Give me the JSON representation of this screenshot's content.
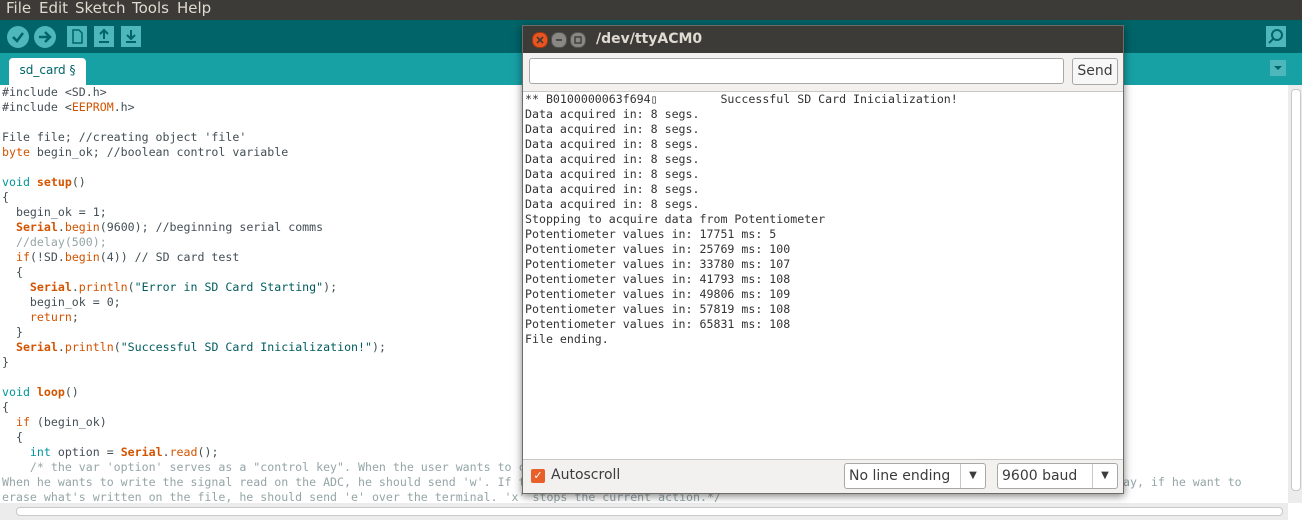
{
  "menu": [
    "File",
    "Edit",
    "Sketch",
    "Tools",
    "Help"
  ],
  "toolbar": {
    "icons": [
      "verify-icon",
      "upload-icon",
      "new-icon",
      "open-icon",
      "save-icon",
      "serial-monitor-icon"
    ]
  },
  "tab": {
    "label": "sd_card §"
  },
  "code": {
    "l1a": "#include <SD.h>",
    "l2a": "#include <",
    "l2b": "EEPROM",
    "l2c": ".h>",
    "l4": "File file; //creating object 'file'",
    "l5a": "byte",
    "l5b": " begin_ok; //boolean control variable",
    "l7a": "void",
    "l7b": "setup",
    "l7c": "()",
    "l8": "{",
    "l9": "  begin_ok = 1;",
    "l10a": "Serial",
    "l10b": ".",
    "l10c": "begin",
    "l10d": "(9600); //beginning serial comms",
    "l11": "  //delay(500);",
    "l12a": "if",
    "l12b": "(!SD.",
    "l12c": "begin",
    "l12d": "(4)) // SD card test",
    "l13": "  {",
    "l14a": "Serial",
    "l14b": ".",
    "l14c": "println",
    "l14d": "(",
    "l14e": "\"Error in SD Card Starting\"",
    "l14f": ");",
    "l15": "    begin_ok = 0;",
    "l16": "return",
    "l16b": ";",
    "l17": "  }",
    "l18a": "Serial",
    "l18b": ".",
    "l18c": "println",
    "l18d": "(",
    "l18e": "\"Successful SD Card Inicialization!\"",
    "l18f": ");",
    "l19": "}",
    "l21a": "void",
    "l21b": "loop",
    "l21c": "()",
    "l22": "{",
    "l23a": "if",
    "l23b": " (begin_ok)",
    "l24": "  {",
    "l25a": "int",
    "l25b": " option = ",
    "l25c": "Serial",
    "l25d": ".",
    "l25e": "read",
    "l25f": "();",
    "l26": "    /* the var 'option' serves as a \"control key\". When the user wants to c",
    "l27a": "When he wants to write the signal read on the ADC, he should send 'w'. If t",
    "l27b": "ay, if he want to",
    "l28": "erase what's written on the file, he should send 'e' over the terminal. 'x' stops the current action.*/"
  },
  "monitor": {
    "title": "/dev/ttyACM0",
    "input_value": "",
    "send_label": "Send",
    "lines": [
      "** B0100000063f694▯         Successful SD Card Inicialization!",
      "Data acquired in: 8 segs.",
      "Data acquired in: 8 segs.",
      "Data acquired in: 8 segs.",
      "Data acquired in: 8 segs.",
      "Data acquired in: 8 segs.",
      "Data acquired in: 8 segs.",
      "Data acquired in: 8 segs.",
      "Stopping to acquire data from Potentiometer",
      "Potentiometer values in: 17751 ms: 5",
      "Potentiometer values in: 25769 ms: 100",
      "Potentiometer values in: 33780 ms: 107",
      "Potentiometer values in: 41793 ms: 108",
      "Potentiometer values in: 49806 ms: 109",
      "Potentiometer values in: 57819 ms: 108",
      "Potentiometer values in: 65831 ms: 108",
      "File ending."
    ],
    "autoscroll_label": "Autoscroll",
    "autoscroll_checked": true,
    "line_ending": "No line ending",
    "baud": "9600 baud"
  },
  "colors": {
    "menubar": "#3c3b37",
    "toolbar": "#006468",
    "tabbar": "#17a1a5",
    "keyword": "#d35400",
    "type": "#00979c",
    "comment": "#95a5a6"
  }
}
